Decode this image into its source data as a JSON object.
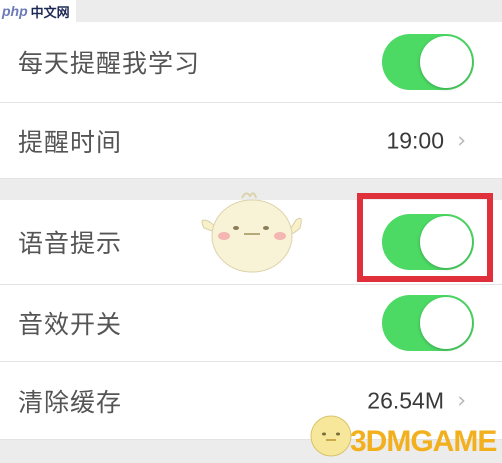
{
  "watermark_top": {
    "logo": "php",
    "text": "中文网"
  },
  "settings": {
    "daily_reminder": {
      "label": "每天提醒我学习",
      "enabled": true
    },
    "reminder_time": {
      "label": "提醒时间",
      "value": "19:00"
    },
    "voice_prompt": {
      "label": "语音提示",
      "enabled": true
    },
    "sound_effects": {
      "label": "音效开关",
      "enabled": true
    },
    "clear_cache": {
      "label": "清除缓存",
      "value": "26.54M"
    }
  },
  "watermark_bottom": {
    "text": "3DMGAME"
  },
  "colors": {
    "toggle_on": "#4cd964",
    "highlight": "#e0303c"
  }
}
